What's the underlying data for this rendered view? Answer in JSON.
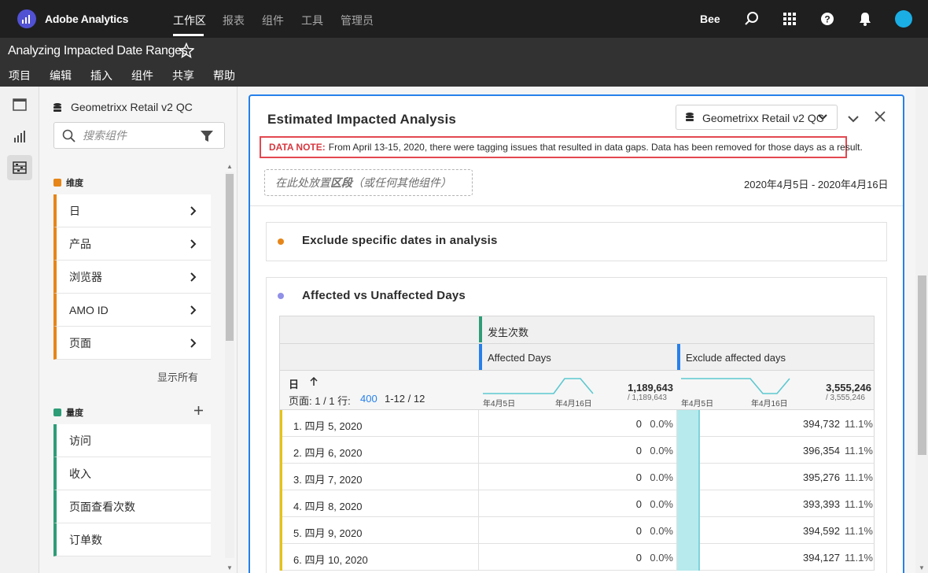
{
  "topnav": {
    "app_name": "Adobe Analytics",
    "items": [
      "工作区",
      "报表",
      "组件",
      "工具",
      "管理员"
    ],
    "user": "Bee"
  },
  "project": {
    "title": "Analyzing Impacted Date Ranges",
    "menu": [
      "项目",
      "编辑",
      "插入",
      "组件",
      "共享",
      "帮助"
    ]
  },
  "components": {
    "report_suite": "Geometrixx Retail v2 QC",
    "search_placeholder": "搜索组件",
    "dimensions_header": "维度",
    "dimensions": [
      "日",
      "产品",
      "浏览器",
      "AMO ID",
      "页面"
    ],
    "show_all": "显示所有",
    "metrics_header": "量度",
    "metrics": [
      "访问",
      "收入",
      "页面查看次数",
      "订单数"
    ]
  },
  "panel": {
    "title": "Estimated Impacted Analysis",
    "report_suite": "Geometrixx Retail v2 QC",
    "data_note_label": "DATA NOTE:",
    "data_note_text": "From April 13-15, 2020, there were tagging issues that resulted in data gaps. Data has been removed for those days as a result.",
    "drop_zone_prefix": "在此处放置",
    "drop_zone_bold": "区段",
    "drop_zone_suffix": "（或任何其他组件）",
    "date_range": "2020年4月5日 - 2020年4月16日"
  },
  "viz1": {
    "title": "Exclude specific dates in analysis"
  },
  "viz2": {
    "title": "Affected vs Unaffected Days",
    "metric_header": "发生次数",
    "col1_header": "Affected Days",
    "col2_header": "Exclude affected days",
    "dimension_header": "日",
    "sort_icon": "arrow-up-icon",
    "pagination_label": "页面: 1 / 1 行:",
    "rows_per_page": "400",
    "row_range": "1-12 / 12",
    "spark_start": "年4月5日",
    "spark_end": "年4月16日",
    "col1_total": "1,189,643",
    "col1_total_sub": "/ 1,189,643",
    "col2_total": "3,555,246",
    "col2_total_sub": "/ 3,555,246",
    "rows": [
      {
        "label": "1. 四月 5, 2020",
        "v1": "0",
        "p1": "0.0%",
        "v2": "394,732",
        "p2": "11.1%"
      },
      {
        "label": "2. 四月 6, 2020",
        "v1": "0",
        "p1": "0.0%",
        "v2": "396,354",
        "p2": "11.1%"
      },
      {
        "label": "3. 四月 7, 2020",
        "v1": "0",
        "p1": "0.0%",
        "v2": "395,276",
        "p2": "11.1%"
      },
      {
        "label": "4. 四月 8, 2020",
        "v1": "0",
        "p1": "0.0%",
        "v2": "393,393",
        "p2": "11.1%"
      },
      {
        "label": "5. 四月 9, 2020",
        "v1": "0",
        "p1": "0.0%",
        "v2": "394,592",
        "p2": "11.1%"
      },
      {
        "label": "6. 四月 10, 2020",
        "v1": "0",
        "p1": "0.0%",
        "v2": "394,127",
        "p2": "11.1%"
      }
    ]
  },
  "colors": {
    "accent": "#2680eb",
    "dimension": "#e68619",
    "metric": "#2d9d78",
    "note_red": "#e34850",
    "sparkline": "#5bc8d0",
    "viz1_dot": "#e68619",
    "viz2_dot": "#9090e8"
  }
}
